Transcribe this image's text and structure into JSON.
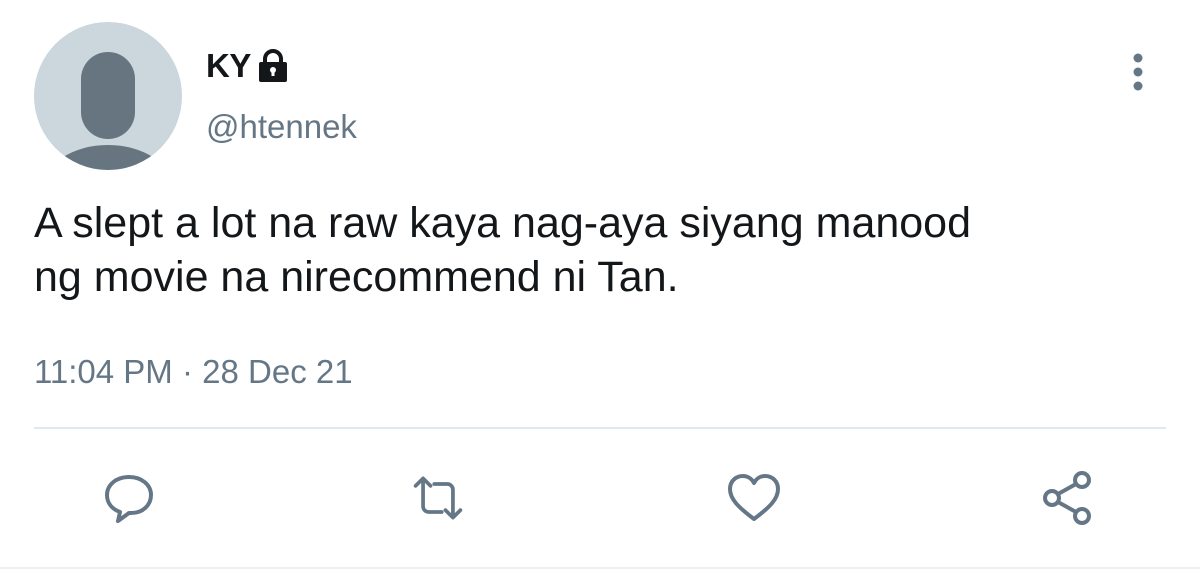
{
  "user": {
    "display_name": "KY",
    "handle": "@htennek",
    "protected": true,
    "avatar": "default-avatar"
  },
  "tweet": {
    "text_lines": [
      "A slept a lot na raw kaya nag-aya siyang manood",
      "ng movie na nirecommend ni Tan."
    ],
    "time": "11:04 PM",
    "separator": "·",
    "date": "28 Dec 21"
  },
  "actions": [
    {
      "name": "reply",
      "icon": "reply-icon"
    },
    {
      "name": "retweet",
      "icon": "retweet-icon"
    },
    {
      "name": "like",
      "icon": "heart-icon"
    },
    {
      "name": "share",
      "icon": "share-icon"
    }
  ],
  "colors": {
    "text_primary": "#14171a",
    "text_secondary": "#657786",
    "avatar_bg": "#ccd6dd",
    "avatar_fg": "#66757f",
    "divider": "#e1e8ed"
  }
}
